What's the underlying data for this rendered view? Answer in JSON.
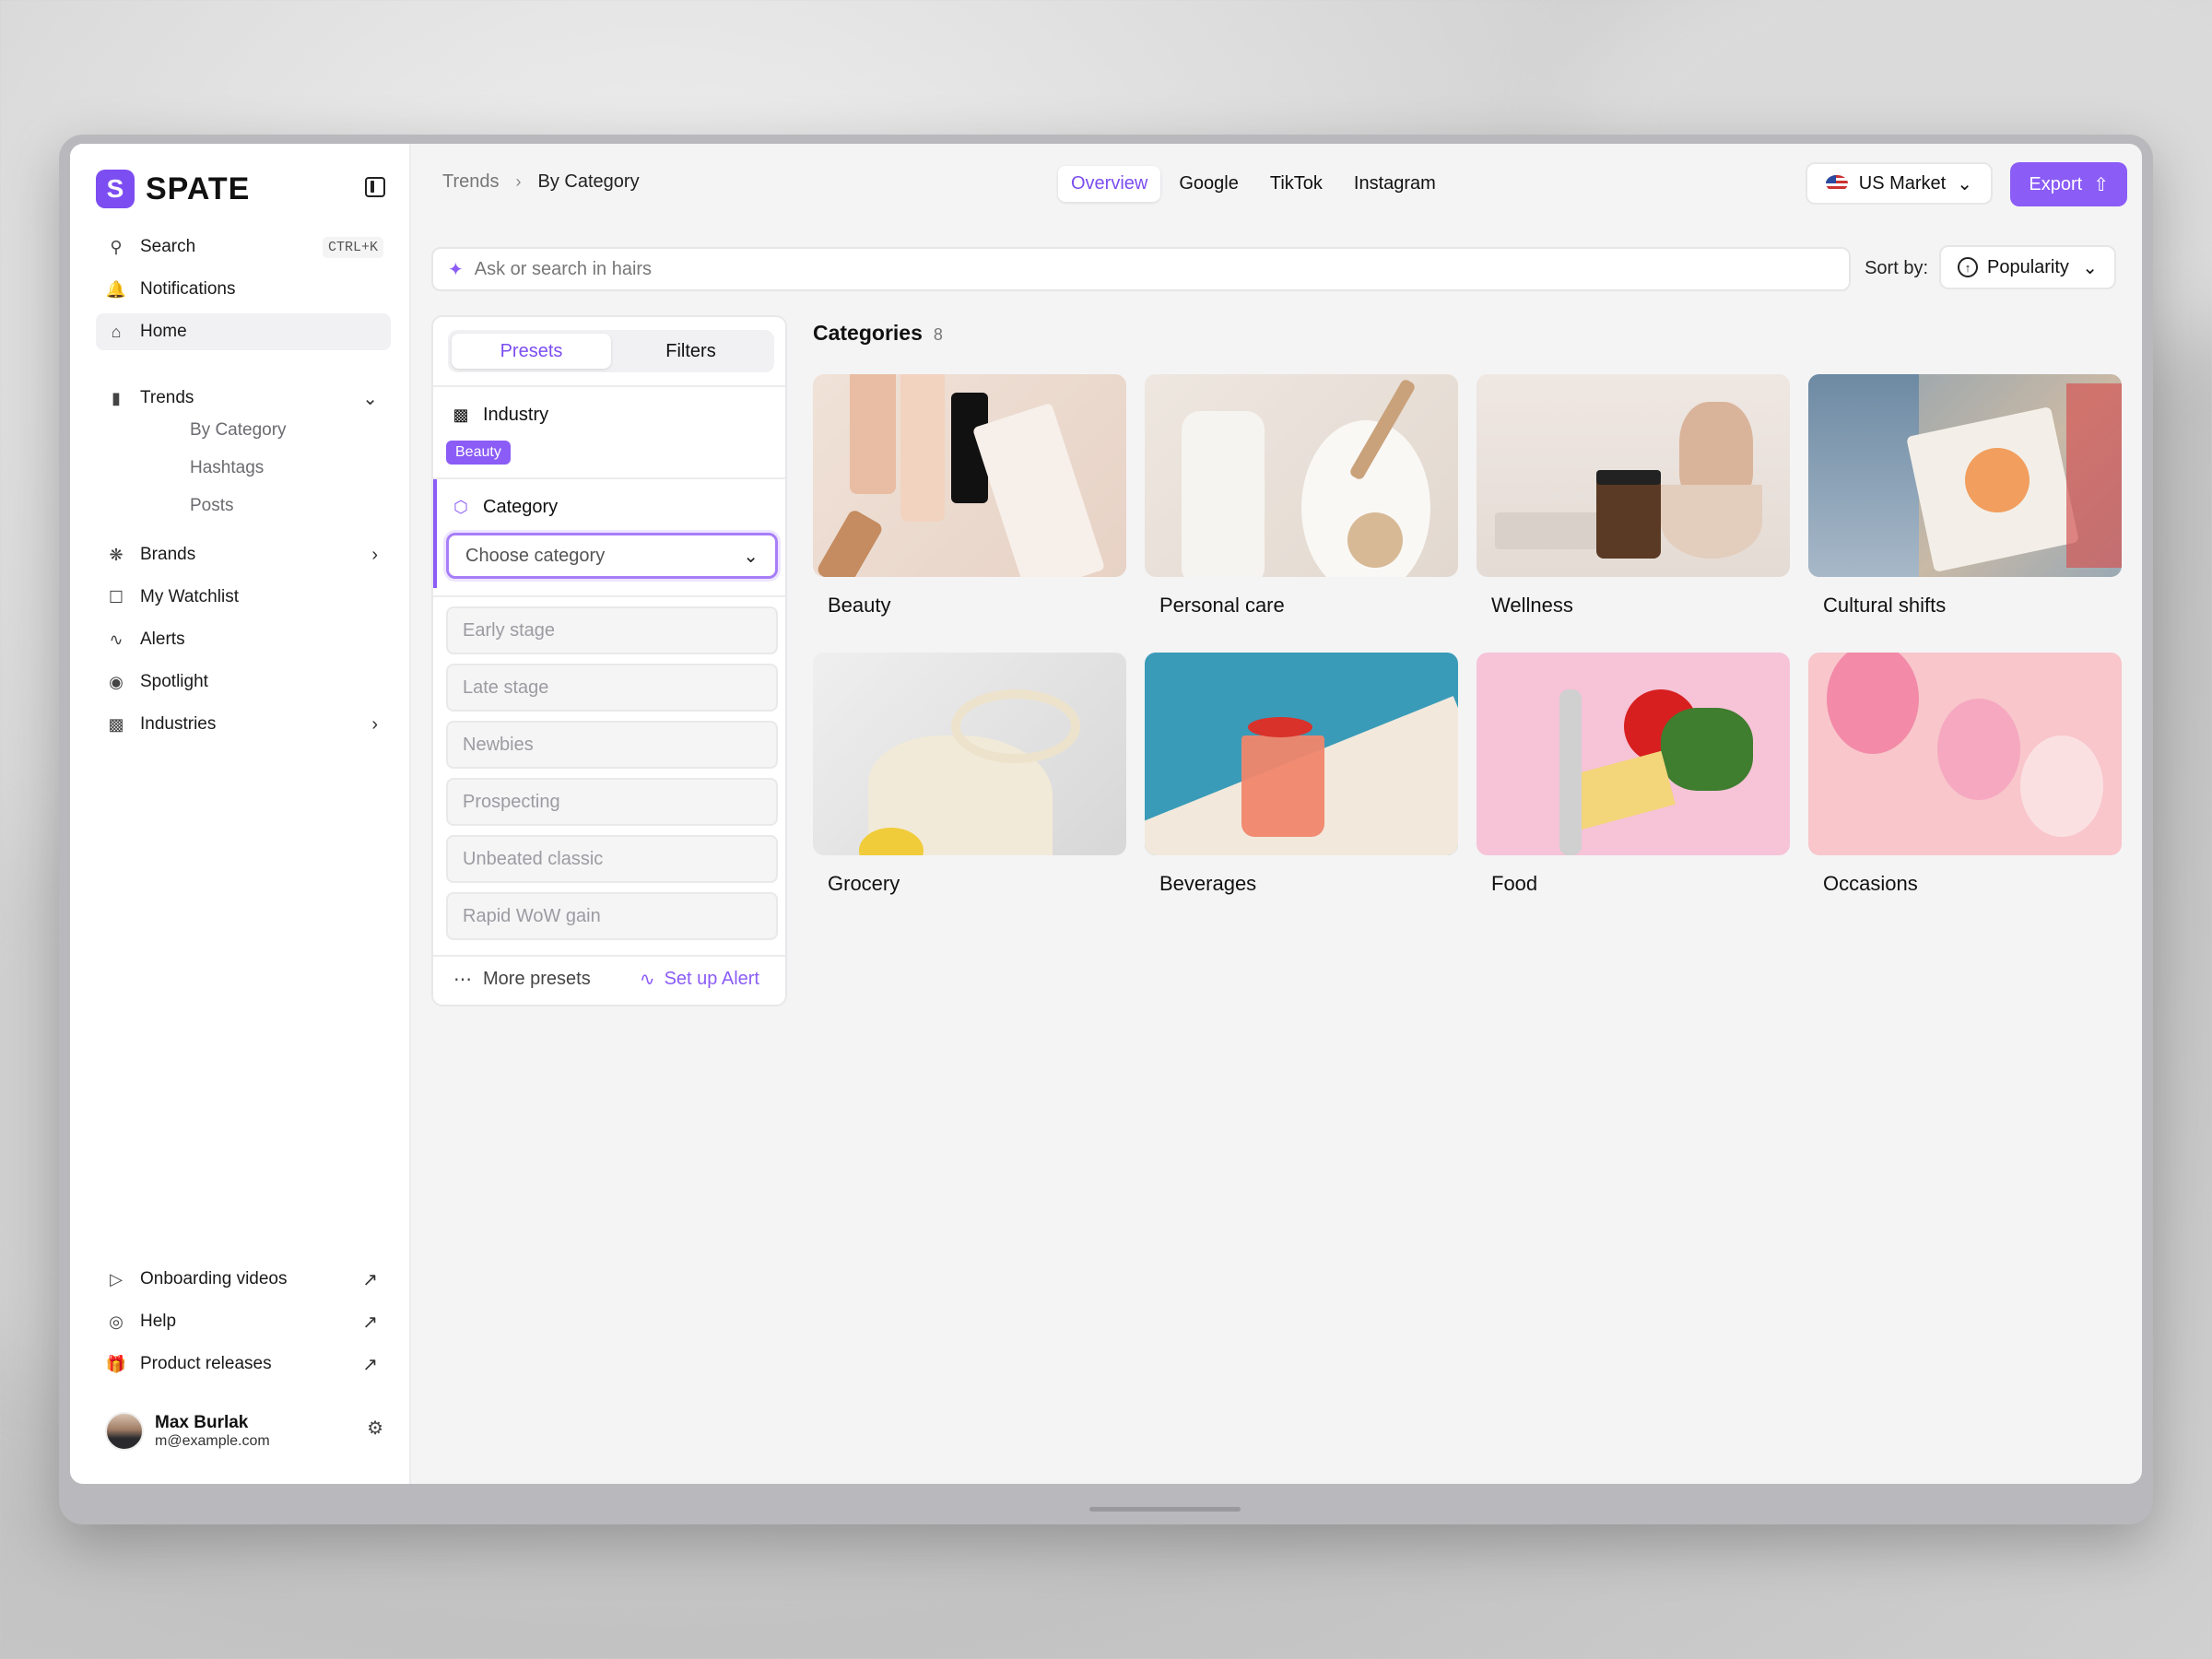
{
  "app": {
    "logo_text": "SPATE",
    "brand_color": "#8b5cf6"
  },
  "sidebar": {
    "search": {
      "label": "Search",
      "shortcut": "CTRL+K"
    },
    "items": [
      {
        "label": "Notifications",
        "icon": "bell-icon"
      },
      {
        "label": "Home",
        "icon": "home-icon"
      },
      {
        "label": "Trends",
        "icon": "bar-chart-icon"
      },
      {
        "label": "Brands",
        "icon": "brands-icon"
      },
      {
        "label": "My Watchlist",
        "icon": "bookmark-icon"
      },
      {
        "label": "Alerts",
        "icon": "pulse-icon"
      },
      {
        "label": "Spotlight",
        "icon": "spotlight-icon"
      },
      {
        "label": "Industries",
        "icon": "factory-icon"
      }
    ],
    "trends_sub": [
      "By Category",
      "Hashtags",
      "Posts"
    ],
    "footer_links": [
      {
        "label": "Onboarding videos",
        "icon": "video-icon"
      },
      {
        "label": "Help",
        "icon": "lifebuoy-icon"
      },
      {
        "label": "Product releases",
        "icon": "gift-icon"
      }
    ],
    "user": {
      "name": "Max Burlak",
      "email": "m@example.com"
    }
  },
  "header": {
    "breadcrumb": [
      "Trends",
      "By Category"
    ],
    "tabs": [
      "Overview",
      "Google",
      "TikTok",
      "Instagram"
    ],
    "active_tab": "Overview",
    "market": "US Market",
    "export_label": "Export"
  },
  "search": {
    "placeholder": "Ask or search in hairs"
  },
  "sort": {
    "label": "Sort by:",
    "value": "Popularity"
  },
  "filter_panel": {
    "segments": [
      "Presets",
      "Filters"
    ],
    "industry": {
      "title": "Industry",
      "tag": "Beauty"
    },
    "category": {
      "title": "Category",
      "placeholder": "Choose category"
    },
    "presets": [
      "Early stage",
      "Late stage",
      "Newbies",
      "Prospecting",
      "Unbeated classic",
      "Rapid  WoW gain"
    ],
    "more_presets": "More presets",
    "setup_alert": "Set up Alert"
  },
  "categories": {
    "title": "Categories",
    "count": "8",
    "items": [
      "Beauty",
      "Personal care",
      "Wellness",
      "Cultural shifts",
      "Grocery",
      "Beverages",
      "Food",
      "Occasions"
    ]
  }
}
